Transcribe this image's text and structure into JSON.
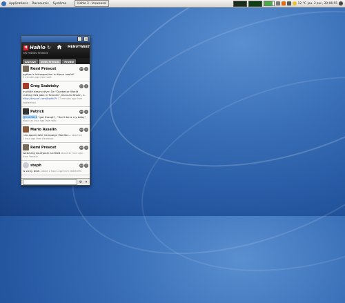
{
  "panel": {
    "menus": [
      "Applications",
      "Raccourcis",
      "Système"
    ],
    "task_button": "Hahlo 3 - Iceweasel",
    "clock": "jeu. 2 avr., 20:06:55",
    "temperature": "12 °C",
    "battery_level": 0.85
  },
  "app": {
    "logo_letter": "H",
    "logo_text": "Hahlo",
    "menu_label": "MENU",
    "tweet_label": "TWEET",
    "subtitle": "My Friends Timeline",
    "tabs": [
      "Archive",
      "With Friends",
      "Profile"
    ]
  },
  "tweets": [
    {
      "name": "Rémi Prévost",
      "text": "python's introspection is damn useful!",
      "meta": "2 minutes ago from web",
      "avatar_color": "#7a6a5a"
    },
    {
      "name": "Greg Sadetsky",
      "text": "Inutilité destructive: De \"Quebecor World cutting 320 jobs in Toronto\", Duncan Brown, n.",
      "link": "http://tinyurl.com/bwkb7f",
      "meta": "17 minutes ago from twitterfeed",
      "avatar_color": "#a83a2a"
    },
    {
      "name": "Patrick",
      "mention": "@2003010",
      "text": "\"got though\", \"don't be a cry baby\"",
      "meta": "about an hour ago from web",
      "avatar_color": "#333333"
    },
    {
      "name": "Mario Asselin",
      "text": "I do appreciate Campaign Monitor...",
      "meta": "1 hour ago from Facebook",
      "meta_right": "about an",
      "avatar_color": "#8a5a3a"
    },
    {
      "name": "Rémi Prévost",
      "text": "watching southpark s13e06",
      "meta": "from Tweetie",
      "meta_right": "about an hour ago",
      "avatar_color": "#7a6a5a"
    },
    {
      "name": "steph",
      "text": "is sicky. blah.",
      "meta": "about 2 hours ago from twitterrific",
      "avatar_color": "#c8ccd4"
    }
  ]
}
